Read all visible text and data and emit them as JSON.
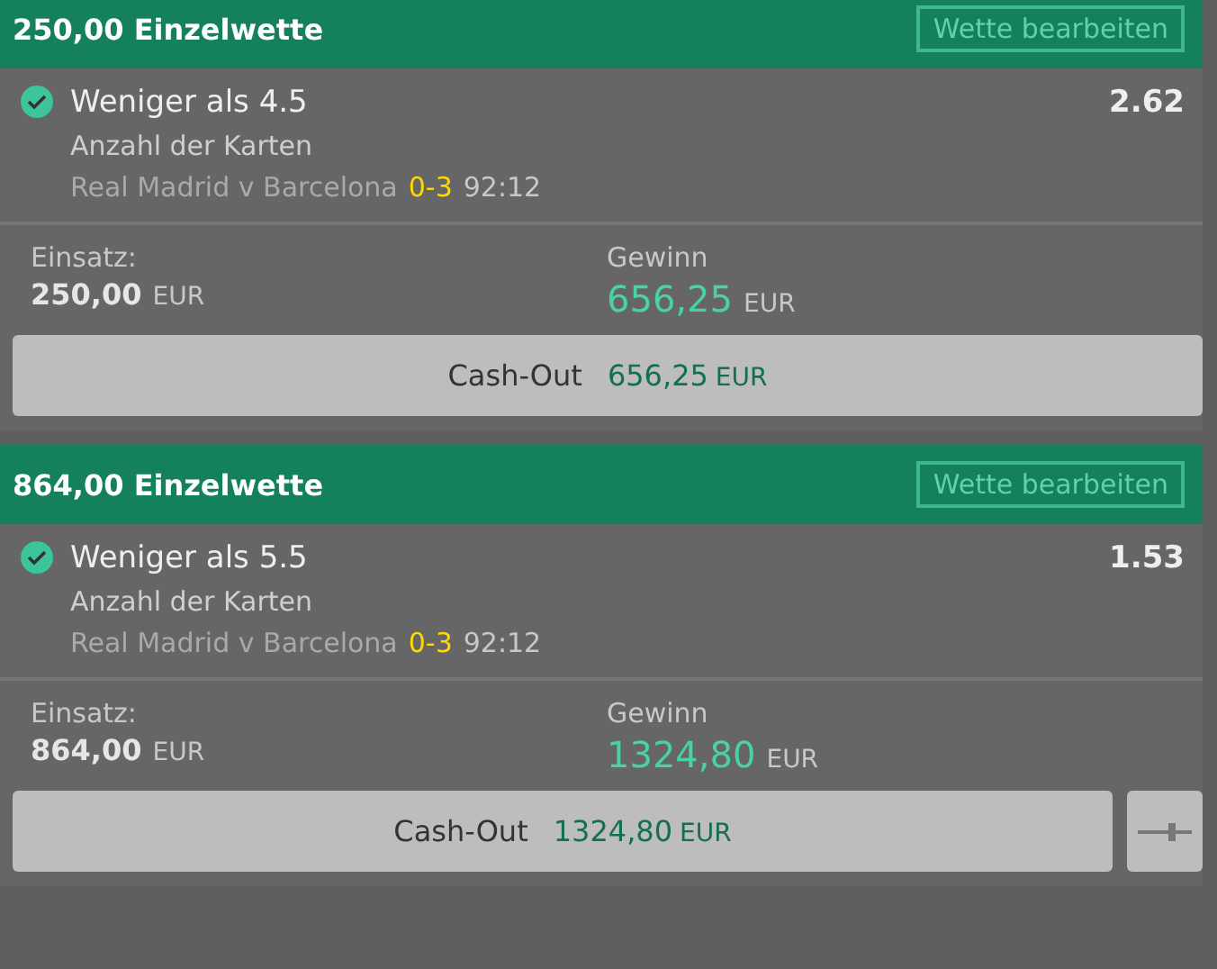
{
  "bets": [
    {
      "title": "250,00 Einzelwette",
      "edit_button": "Wette bearbeiten",
      "selection": "Weniger als 4.5",
      "settled": true,
      "odds": "2.62",
      "market": "Anzahl der Karten",
      "event": "Real Madrid v Barcelona",
      "score": "0-3",
      "clock": "92:12",
      "stake_label": "Einsatz:",
      "stake": "250,00",
      "stake_currency": "EUR",
      "return_label": "Gewinn",
      "return": "656,25",
      "return_currency": "EUR",
      "cashout_label": "Cash-Out",
      "cashout_amount": "656,25",
      "cashout_currency": "EUR",
      "partial_cashout": false
    },
    {
      "title": "864,00 Einzelwette",
      "edit_button": "Wette bearbeiten",
      "selection": "Weniger als 5.5",
      "settled": true,
      "odds": "1.53",
      "market": "Anzahl der Karten",
      "event": "Real Madrid v Barcelona",
      "score": "0-3",
      "clock": "92:12",
      "stake_label": "Einsatz:",
      "stake": "864,00",
      "stake_currency": "EUR",
      "return_label": "Gewinn",
      "return": "1324,80",
      "return_currency": "EUR",
      "cashout_label": "Cash-Out",
      "cashout_amount": "1324,80",
      "cashout_currency": "EUR",
      "partial_cashout": true
    }
  ]
}
